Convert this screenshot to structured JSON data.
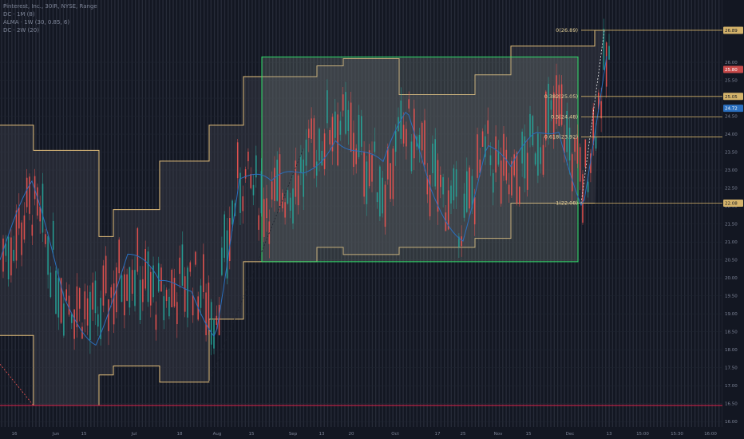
{
  "legend": {
    "symbol_line": "Pinterest, Inc., 30IR, NYSE, Range",
    "indicators": [
      "DC · 1M (8)",
      "ALMA · 1W (30, 0.85, 6)",
      "DC · 2W (20)"
    ]
  },
  "colors": {
    "background": "#131722",
    "candle_up": "#26a69a",
    "candle_down": "#ef5350",
    "donchian": "#e5c07b",
    "alma": "#2a6fbf",
    "box_border": "#2ee06a",
    "support": "#e0214b",
    "fib": "#d4b36a"
  },
  "chart_data": {
    "type": "candlestick",
    "title": "",
    "xlabel": "",
    "ylabel": "",
    "ylim": [
      15.85,
      27.4
    ],
    "x_ticks": [
      "16",
      "Jun",
      "15",
      "Jul",
      "18",
      "Aug",
      "15",
      "Sep",
      "13",
      "20",
      "Oct",
      "17",
      "25",
      "Nov",
      "15",
      "Dec",
      "13",
      "15:00",
      "15:30",
      "16:00"
    ],
    "y_ticks": [
      "26.00",
      "25.50",
      "25.00",
      "24.50",
      "24.00",
      "23.50",
      "23.00",
      "22.50",
      "22.00",
      "21.50",
      "21.00",
      "20.50",
      "20.00",
      "19.50",
      "19.00",
      "18.50",
      "18.00",
      "17.50",
      "17.00",
      "16.50",
      "16.00"
    ],
    "price_labels": [
      {
        "value": 26.89,
        "text": "26.89",
        "kind": "fib"
      },
      {
        "value": 25.8,
        "text": "25.80",
        "kind": "last"
      },
      {
        "value": 25.05,
        "text": "25.05",
        "kind": "fib"
      },
      {
        "value": 24.72,
        "text": "24.72",
        "kind": "alma"
      },
      {
        "value": 22.08,
        "text": "22.08",
        "kind": "fib"
      }
    ],
    "fib_levels": [
      {
        "ratio": "0",
        "value": 26.89,
        "label": "0(26.89)"
      },
      {
        "ratio": "0.382",
        "value": 25.05,
        "label": "0.382(25.05)"
      },
      {
        "ratio": "0.5",
        "value": 24.48,
        "label": "0.5(24.48)"
      },
      {
        "ratio": "0.618",
        "value": 23.92,
        "label": "0.618(23.92)"
      },
      {
        "ratio": "1",
        "value": 22.08,
        "label": "1(22.08)"
      }
    ],
    "rectangle": {
      "start_month": "Aug",
      "end_month": "Dec",
      "top": 26.15,
      "bottom": 20.45
    },
    "support_line": 16.45,
    "donchian_monthly": {
      "upper": [
        {
          "from": "Apr",
          "value": 24.25
        },
        {
          "from": "Jun",
          "value": 23.55
        },
        {
          "from": "Jun",
          "value": 21.15
        },
        {
          "from": "Jul",
          "value": 21.9
        },
        {
          "from": "Aug",
          "value": 23.25
        },
        {
          "from": "Aug",
          "value": 24.25
        },
        {
          "from": "Sep",
          "value": 25.6
        },
        {
          "from": "Oct",
          "value": 25.9
        },
        {
          "from": "Oct",
          "value": 26.1
        },
        {
          "from": "Nov",
          "value": 25.1
        },
        {
          "from": "Nov",
          "value": 25.65
        },
        {
          "from": "Dec",
          "value": 26.45
        },
        {
          "from": "Dec",
          "value": 26.89
        }
      ],
      "lower": [
        {
          "from": "Apr",
          "value": 18.4
        },
        {
          "from": "Jun",
          "value": 16.45
        },
        {
          "from": "Jun",
          "value": 17.3
        },
        {
          "from": "Jul",
          "value": 17.55
        },
        {
          "from": "Aug",
          "value": 17.1
        },
        {
          "from": "Aug",
          "value": 18.85
        },
        {
          "from": "Sep",
          "value": 20.45
        },
        {
          "from": "Oct",
          "value": 20.85
        },
        {
          "from": "Nov",
          "value": 20.65
        },
        {
          "from": "Nov",
          "value": 20.85
        },
        {
          "from": "Dec",
          "value": 21.1
        },
        {
          "from": "Dec",
          "value": 22.08
        }
      ]
    },
    "last_price": 25.8
  }
}
